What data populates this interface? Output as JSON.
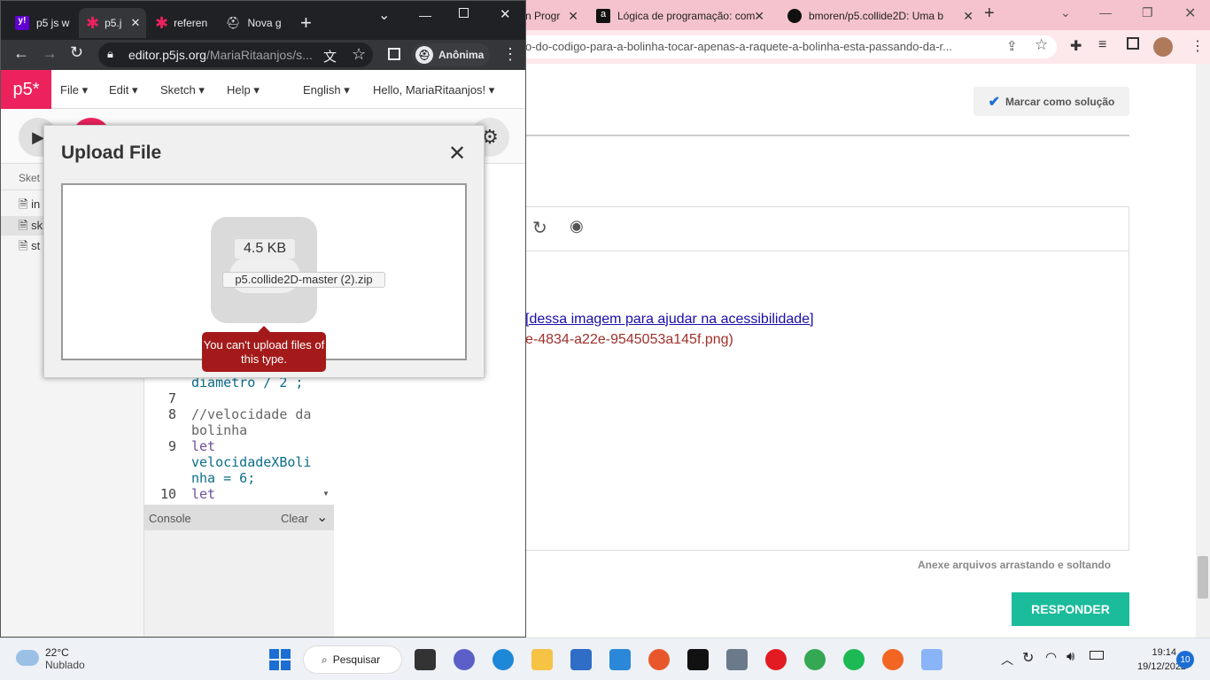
{
  "back_browser": {
    "tabs": [
      {
        "title": "n Progr"
      },
      {
        "title": "Lógica de programação: com"
      },
      {
        "title": "bmoren/p5.collide2D: Uma b"
      }
    ],
    "new_tab": "+",
    "url": "o-do-codigo-para-a-bolinha-tocar-apenas-a-raquete-a-bolinha-esta-passando-da-r...",
    "mark_solution": "Marcar como solução",
    "link_text": "[dessa imagem para ajudar na acessibilidade]",
    "image_ref": "e-4834-a22e-9545053a145f.png)",
    "attach_hint": "Anexe arquivos arrastando e soltando",
    "reply_button": "RESPONDER"
  },
  "front_browser": {
    "tabs": [
      {
        "title": "p5 js w"
      },
      {
        "title": "p5.j"
      },
      {
        "title": "referen"
      },
      {
        "title": "Nova g"
      }
    ],
    "new_tab": "+",
    "url_host": "editor.p5js.org",
    "url_path": "/MariaRitaanjos/s...",
    "incognito_label": "Anônima"
  },
  "p5_editor": {
    "logo": "p5*",
    "menu": [
      "File",
      "Edit",
      "Sketch",
      "Help"
    ],
    "language": "English",
    "greeting": "Hello, MariaRitaanjos!",
    "sidebar_header": "Sket",
    "files": [
      "in",
      "sk",
      "st"
    ],
    "code_lines": [
      {
        "num": "",
        "text": "diametro / 2 ;"
      },
      {
        "num": "7",
        "text": ""
      },
      {
        "num": "8",
        "text": "//velocidade da"
      },
      {
        "num": "",
        "text": "bolinha"
      },
      {
        "num": "9",
        "text": "let"
      },
      {
        "num": "",
        "text": "velocidadeXBoli"
      },
      {
        "num": "",
        "text": "nha = 6;"
      },
      {
        "num": "10",
        "text": "let"
      }
    ],
    "console_label": "Console",
    "console_clear": "Clear"
  },
  "upload_modal": {
    "title": "Upload File",
    "file_size": "4.5 KB",
    "file_name": "p5.collide2D-master (2).zip",
    "error": "You can't upload files of this type."
  },
  "taskbar": {
    "temperature": "22°C",
    "weather": "Nublado",
    "search": "Pesquisar",
    "time": "19:14",
    "date": "19/12/2022",
    "notifications": "10"
  },
  "colors": {
    "p5_pink": "#ed225d",
    "chrome_dark": "#202124",
    "back_tabbar": "#f5c3cd",
    "reply_green": "#1bbc9b",
    "error_red": "#a41a1a"
  }
}
